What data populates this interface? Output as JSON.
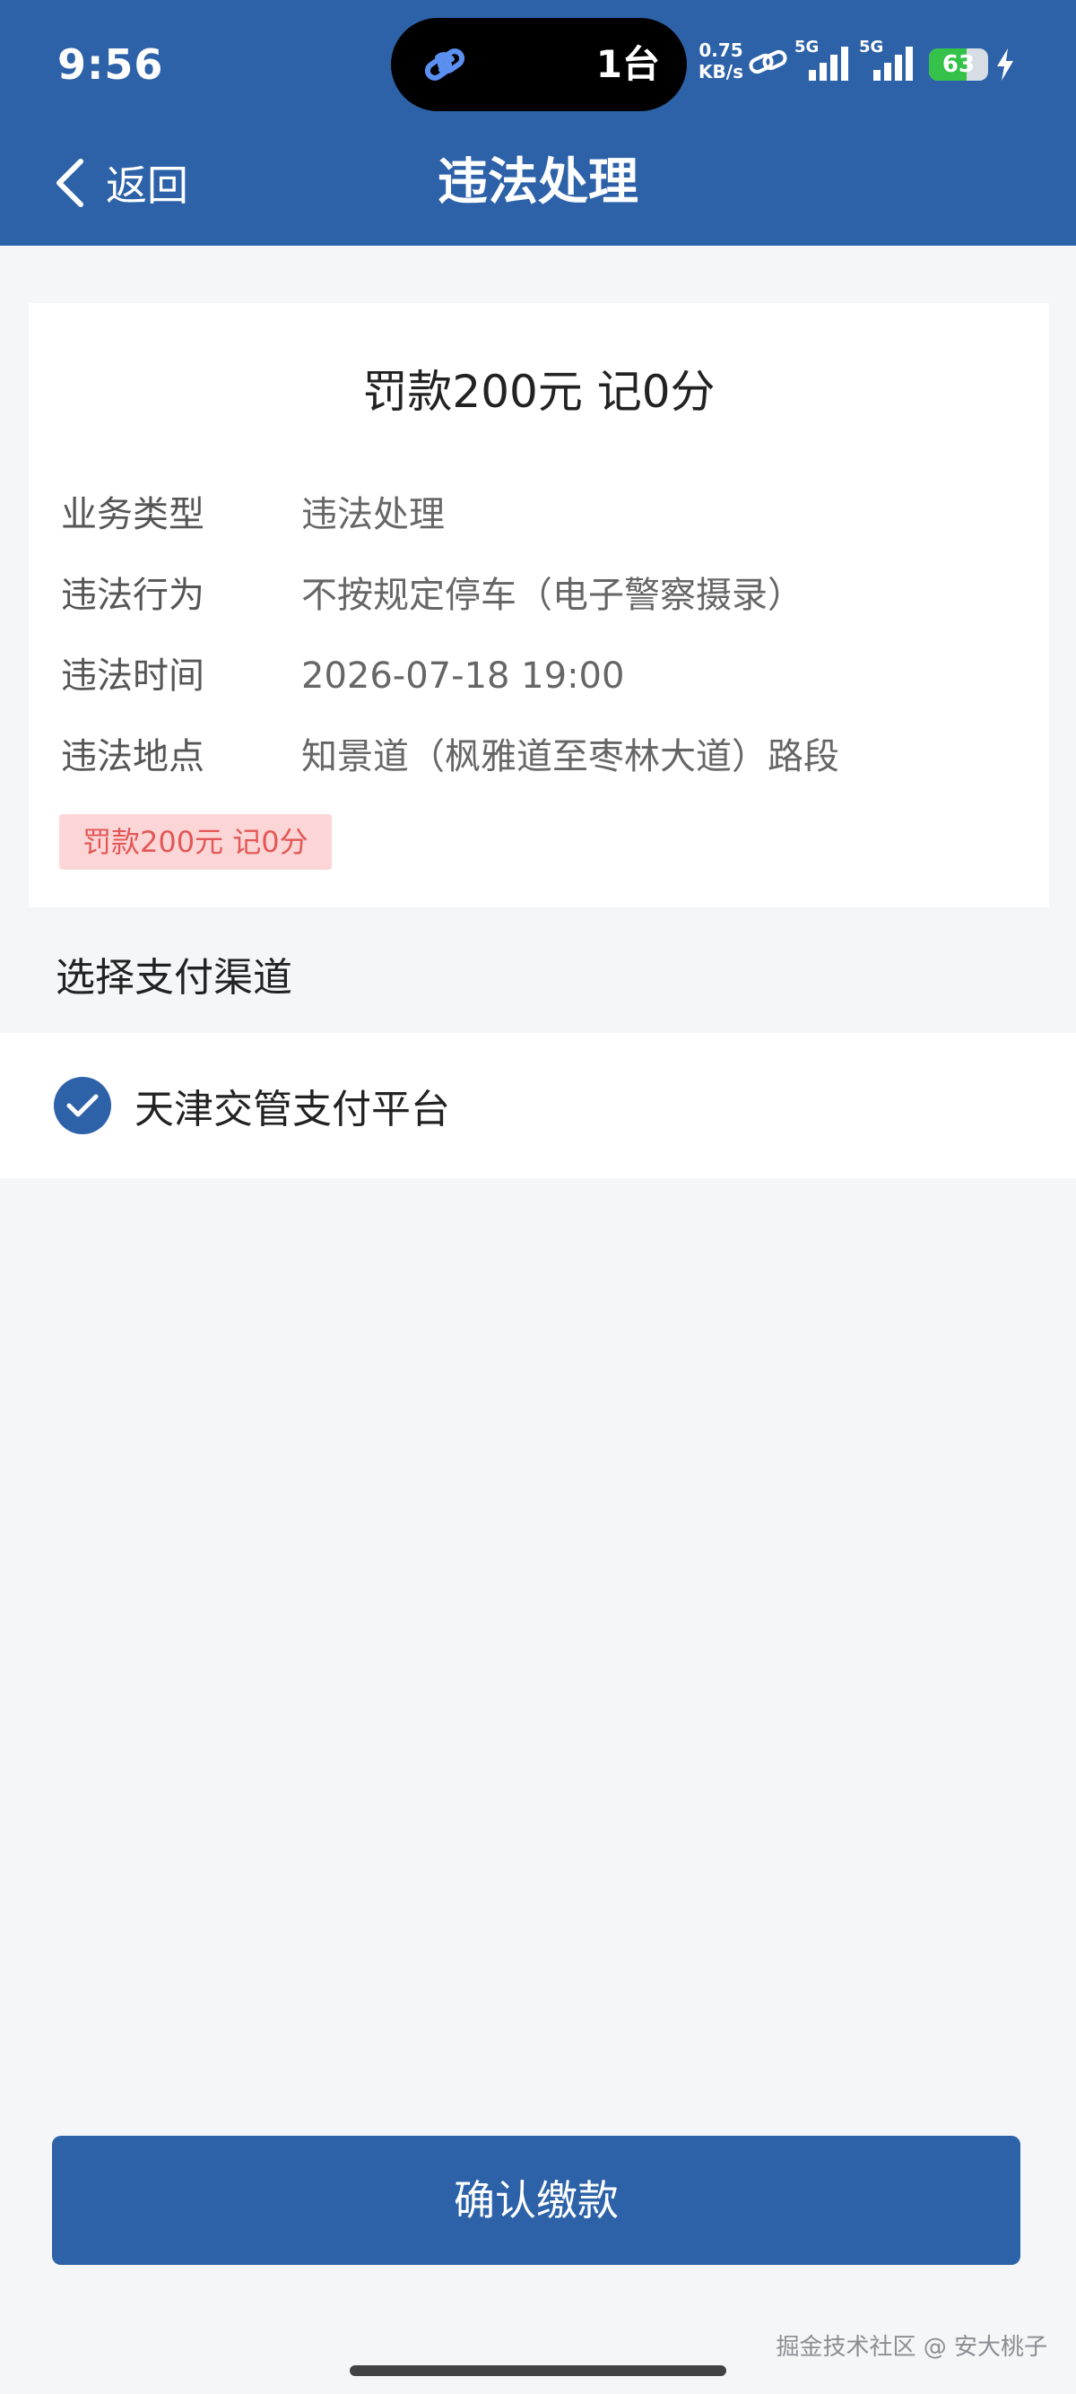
{
  "status_bar": {
    "time": "9:56",
    "island_text": "1台",
    "net_speed_value": "0.75",
    "net_speed_unit": "KB/s",
    "signal1_label": "5G",
    "signal2_label": "5G",
    "battery_level": "63",
    "battery_fraction": 0.63,
    "battery_color": "#35c24a",
    "icons": [
      "link-icon",
      "link-icon",
      "signal-icon",
      "signal-icon",
      "battery-icon",
      "charging-icon"
    ]
  },
  "nav": {
    "back_label": "返回",
    "title": "违法处理"
  },
  "card": {
    "title": "罚款200元 记0分",
    "rows": [
      {
        "label": "业务类型",
        "value": "违法处理"
      },
      {
        "label": "违法行为",
        "value": "不按规定停车（电子警察摄录）"
      },
      {
        "label": "违法时间",
        "value": "2026-07-18 19:00"
      },
      {
        "label": "违法地点",
        "value": "知景道（枫雅道至枣林大道）路段"
      }
    ],
    "tag": "罚款200元 记0分"
  },
  "payment": {
    "section_title": "选择支付渠道",
    "channel_label": "天津交管支付平台",
    "selected": true
  },
  "confirm_label": "确认缴款",
  "watermark": "掘金技术社区 @ 安大桃子",
  "colors": {
    "brand": "#2d62a8",
    "tag_bg": "#fcd6d6",
    "tag_text": "#e35757",
    "background": "#f4f6f7"
  }
}
